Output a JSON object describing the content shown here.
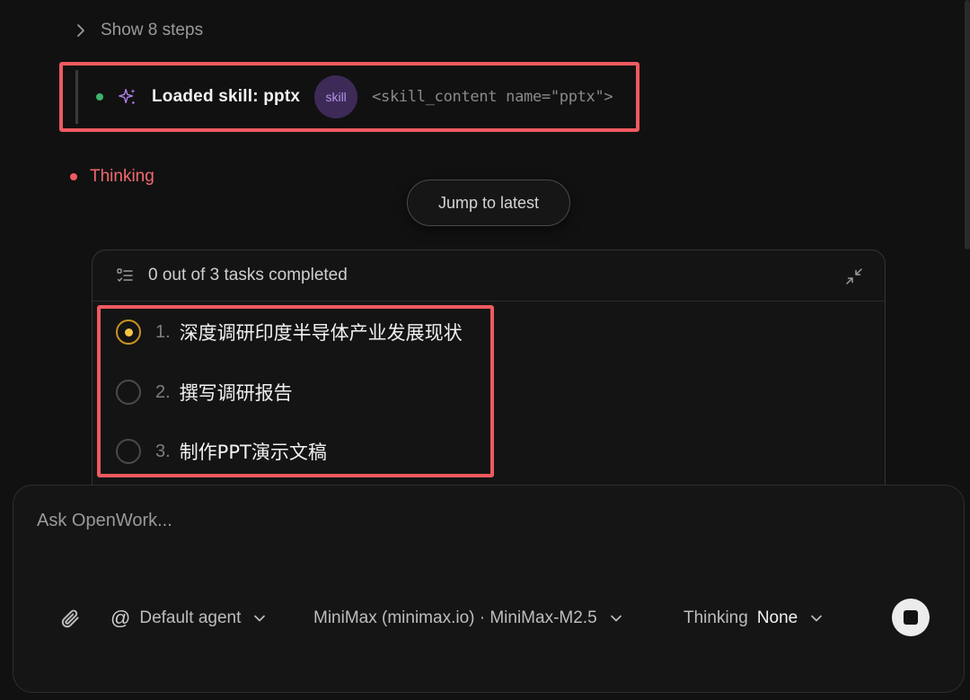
{
  "steps": {
    "toggle_label": "Show 8 steps"
  },
  "skill": {
    "title": "Loaded skill: pptx",
    "badge": "skill",
    "content": "<skill_content name=\"pptx\">"
  },
  "status": {
    "thinking": "Thinking"
  },
  "jump_button": "Jump to latest",
  "tasks": {
    "header": "0 out of 3 tasks completed",
    "items": [
      {
        "num": "1.",
        "label": "深度调研印度半导体产业发展现状",
        "state": "in_progress"
      },
      {
        "num": "2.",
        "label": "撰写调研报告",
        "state": "pending"
      },
      {
        "num": "3.",
        "label": "制作PPT演示文稿",
        "state": "pending"
      }
    ]
  },
  "composer": {
    "placeholder": "Ask OpenWork...",
    "agent": "Default agent",
    "model": "MiniMax (minimax.io) · MiniMax-M2.5",
    "thinking_label": "Thinking",
    "thinking_value": "None"
  },
  "icons": {
    "steps": "chevron-right-icon",
    "skill": "sparkle-icon",
    "tasks": "checklist-icon",
    "collapse": "collapse-icon",
    "attach": "paperclip-icon",
    "agent": "at-icon",
    "dropdown": "chevron-down-icon",
    "stop": "stop-icon"
  },
  "colors": {
    "background": "#111111",
    "highlight": "#ef5a5f",
    "skill_dot": "#3fb36b",
    "skill_accent": "#b693e6",
    "thinking": "#ef6a6d",
    "active_task": "#f4c542"
  }
}
